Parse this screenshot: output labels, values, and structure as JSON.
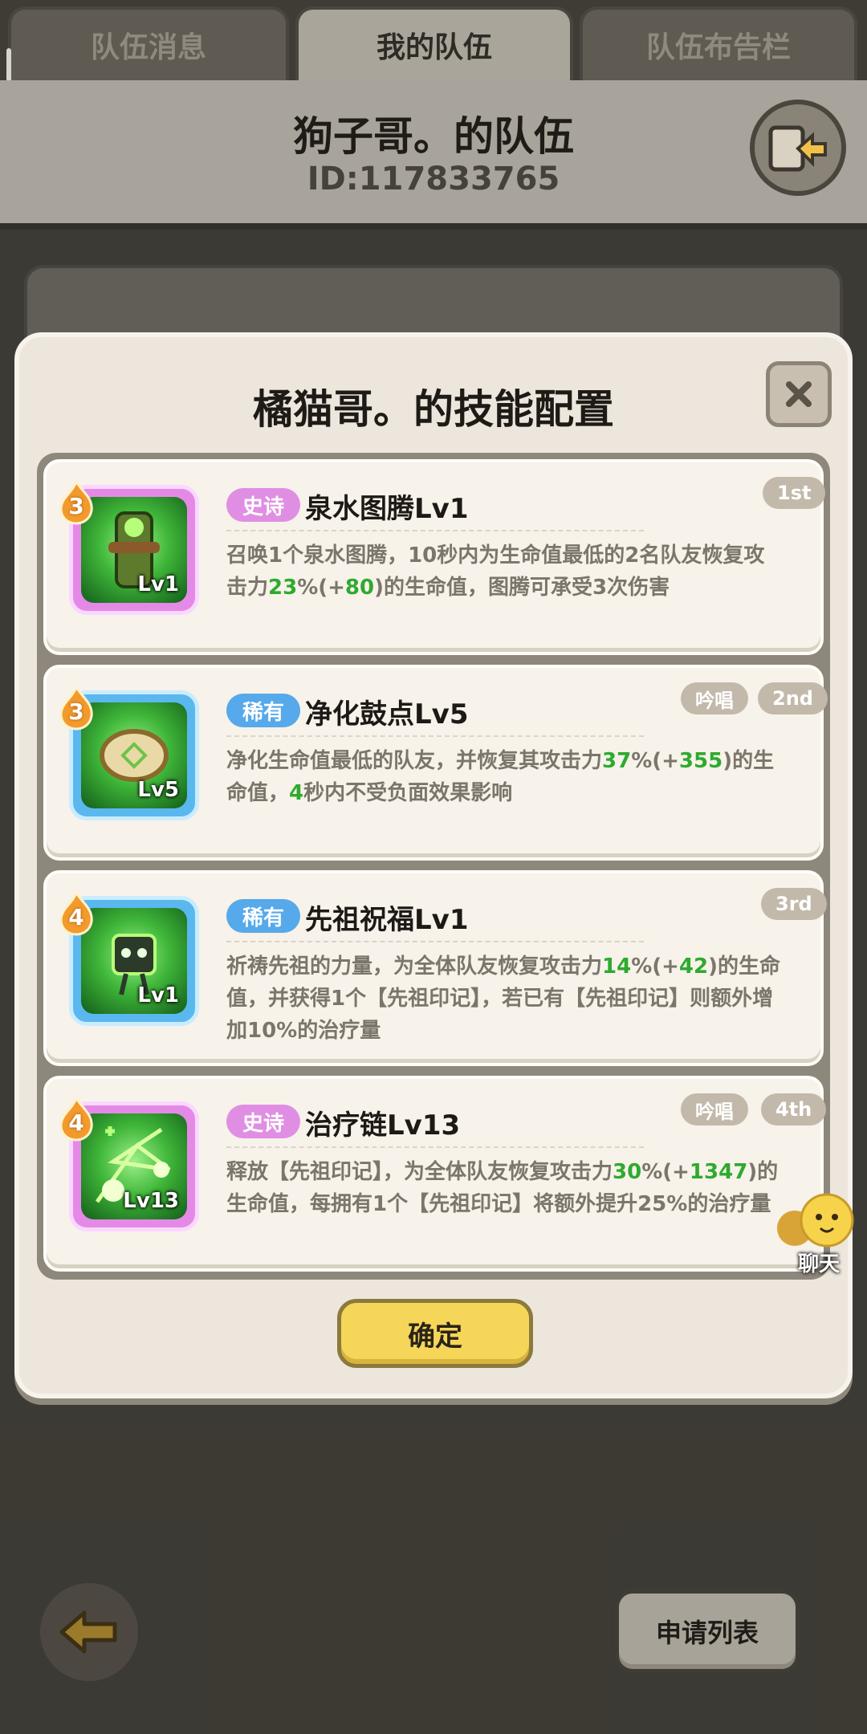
{
  "tabs": [
    {
      "label": "队伍消息",
      "active": false
    },
    {
      "label": "我的队伍",
      "active": true
    },
    {
      "label": "队伍布告栏",
      "active": false
    }
  ],
  "team": {
    "name": "狗子哥。的队伍",
    "id": "ID:117833765"
  },
  "modal": {
    "title": "橘猫哥。的技能配置",
    "confirm_label": "确定",
    "skills": [
      {
        "count": "3",
        "level_label": "Lv1",
        "rarity": "史诗",
        "rarity_type": "epic",
        "name": "泉水图腾Lv1",
        "order": "1st",
        "chant": "",
        "desc_parts": [
          "召唤1个泉水图腾，10秒内为生命值最低的2名队友恢复攻击力",
          "23",
          "%(+",
          "80",
          ")的生命值，图腾可承受3次伤害"
        ]
      },
      {
        "count": "3",
        "level_label": "Lv5",
        "rarity": "稀有",
        "rarity_type": "rare",
        "name": "净化鼓点Lv5",
        "order": "2nd",
        "chant": "吟唱",
        "desc_parts": [
          "净化生命值最低的队友，并恢复其攻击力",
          "37",
          "%(+",
          "355",
          ")的生命值，",
          "4",
          "秒内不受负面效果影响"
        ]
      },
      {
        "count": "4",
        "level_label": "Lv1",
        "rarity": "稀有",
        "rarity_type": "rare",
        "name": "先祖祝福Lv1",
        "order": "3rd",
        "chant": "",
        "desc_parts": [
          "祈祷先祖的力量，为全体队友恢复攻击力",
          "14",
          "%(+",
          "42",
          ")的生命值，并获得1个【先祖印记】，若已有【先祖印记】则额外增加10%的治疗量"
        ]
      },
      {
        "count": "4",
        "level_label": "Lv13",
        "rarity": "史诗",
        "rarity_type": "epic",
        "name": "治疗链Lv13",
        "order": "4th",
        "chant": "吟唱",
        "desc_parts": [
          "释放【先祖印记】，为全体队友恢复攻击力",
          "30",
          "%(+",
          "1347",
          ")的生命值，每拥有1个【先祖印记】将额外提升25%的治疗量"
        ]
      }
    ]
  },
  "chat_label": "聊天",
  "apply_label": "申请列表",
  "colors": {
    "epic": "#e08ee3",
    "rare": "#56a9ea",
    "highlight_green": "#2eaa2e",
    "confirm_yellow": "#f6d659"
  }
}
